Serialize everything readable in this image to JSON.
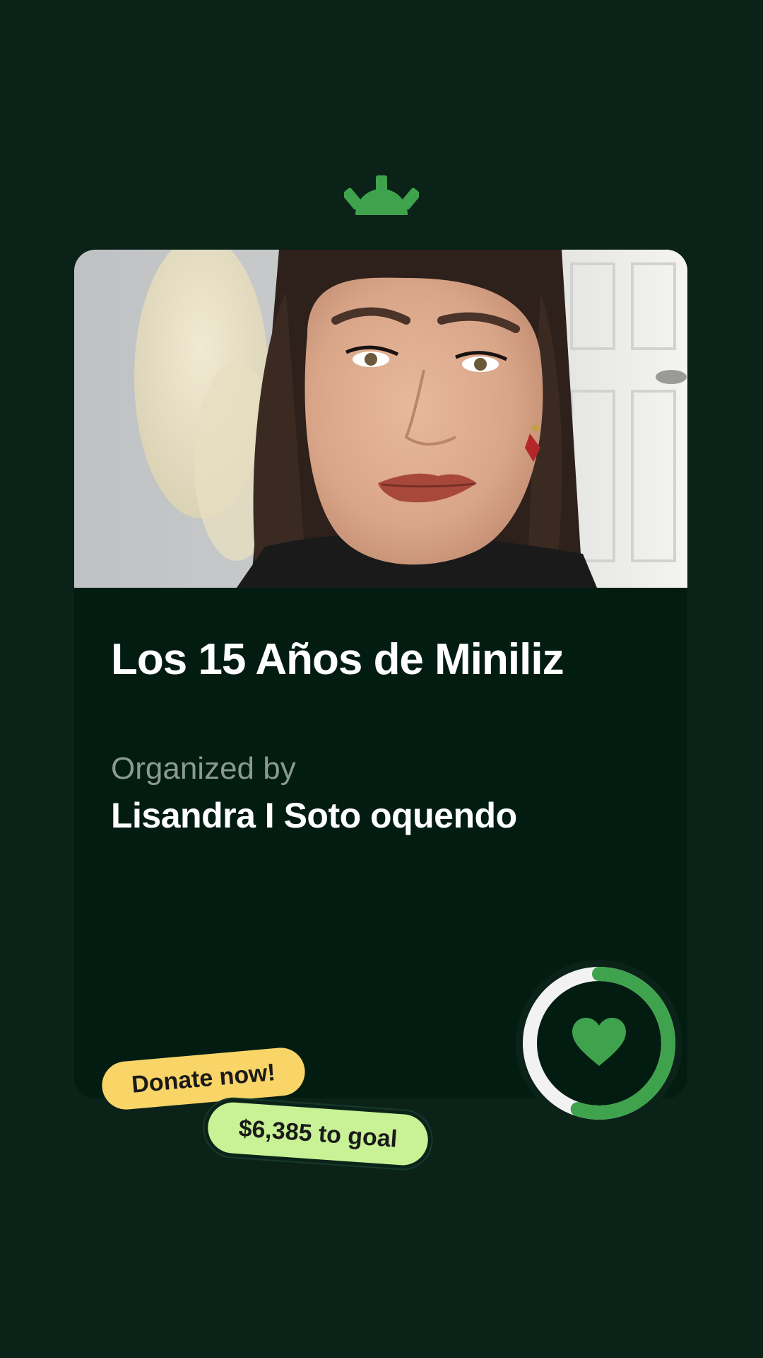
{
  "logo": {
    "icon": "gofundme-sun-icon",
    "color": "#3fa34d"
  },
  "campaign": {
    "photo_alt": "Campaign photo",
    "title": "Los 15 Años de Miniliz",
    "organizer_label": "Organized by",
    "organizer_name": "Lisandra I Soto oquendo"
  },
  "progress": {
    "icon": "heart-icon",
    "fraction": 0.55,
    "accent": "#3fa34d",
    "track": "#f2f2f2"
  },
  "cta": {
    "donate_label": "Donate now!",
    "goal_text": "$6,385 to goal"
  },
  "colors": {
    "background": "#0b2219",
    "card": "#021c12",
    "donate_pill": "#f9d467",
    "goal_pill": "#c8f295"
  }
}
